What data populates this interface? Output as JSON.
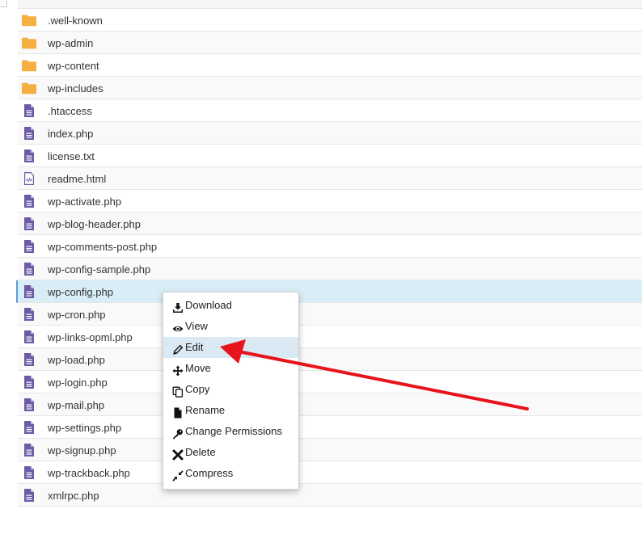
{
  "files": [
    {
      "name": ".well-known",
      "icon": "folder-icon"
    },
    {
      "name": "wp-admin",
      "icon": "folder-icon"
    },
    {
      "name": "wp-content",
      "icon": "folder-icon"
    },
    {
      "name": "wp-includes",
      "icon": "folder-icon"
    },
    {
      "name": ".htaccess",
      "icon": "file-text-icon"
    },
    {
      "name": "index.php",
      "icon": "file-text-icon"
    },
    {
      "name": "license.txt",
      "icon": "file-text-icon"
    },
    {
      "name": "readme.html",
      "icon": "file-code-icon"
    },
    {
      "name": "wp-activate.php",
      "icon": "file-text-icon"
    },
    {
      "name": "wp-blog-header.php",
      "icon": "file-text-icon"
    },
    {
      "name": "wp-comments-post.php",
      "icon": "file-text-icon"
    },
    {
      "name": "wp-config-sample.php",
      "icon": "file-text-icon"
    },
    {
      "name": "wp-config.php",
      "icon": "file-text-icon",
      "selected": true
    },
    {
      "name": "wp-cron.php",
      "icon": "file-text-icon"
    },
    {
      "name": "wp-links-opml.php",
      "icon": "file-text-icon"
    },
    {
      "name": "wp-load.php",
      "icon": "file-text-icon"
    },
    {
      "name": "wp-login.php",
      "icon": "file-text-icon"
    },
    {
      "name": "wp-mail.php",
      "icon": "file-text-icon"
    },
    {
      "name": "wp-settings.php",
      "icon": "file-text-icon"
    },
    {
      "name": "wp-signup.php",
      "icon": "file-text-icon"
    },
    {
      "name": "wp-trackback.php",
      "icon": "file-text-icon"
    },
    {
      "name": "xmlrpc.php",
      "icon": "file-text-icon"
    }
  ],
  "context_menu": {
    "items": [
      {
        "label": "Download",
        "icon": "download-icon"
      },
      {
        "label": "View",
        "icon": "eye-icon"
      },
      {
        "label": "Edit",
        "icon": "pencil-icon",
        "highlighted": true
      },
      {
        "label": "Move",
        "icon": "move-arrows-icon"
      },
      {
        "label": "Copy",
        "icon": "copy-icon"
      },
      {
        "label": "Rename",
        "icon": "file-rename-icon"
      },
      {
        "label": "Change Permissions",
        "icon": "key-icon"
      },
      {
        "label": "Delete",
        "icon": "x-icon"
      },
      {
        "label": "Compress",
        "icon": "compress-icon"
      }
    ]
  },
  "colors": {
    "folder": "#f5b041",
    "file": "#6c5aa6",
    "selected_row": "#d9edf7",
    "menu_highlight": "#dbe9f5",
    "annotation_arrow": "#e8141b"
  }
}
